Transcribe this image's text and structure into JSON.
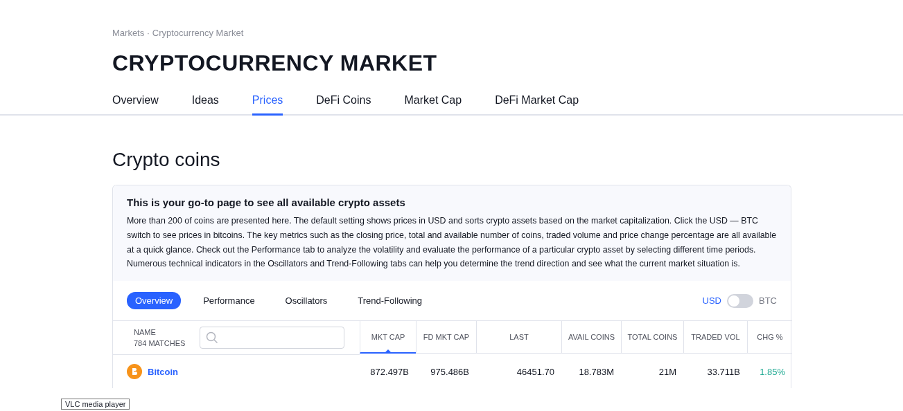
{
  "breadcrumb": "Markets · Cryptocurrency Market",
  "title": "CRYPTOCURRENCY MARKET",
  "tabs": [
    {
      "label": "Overview",
      "selected": false
    },
    {
      "label": "Ideas",
      "selected": false
    },
    {
      "label": "Prices",
      "selected": true
    },
    {
      "label": "DeFi Coins",
      "selected": false
    },
    {
      "label": "Market Cap",
      "selected": false
    },
    {
      "label": "DeFi Market Cap",
      "selected": false
    }
  ],
  "section_title": "Crypto coins",
  "info": {
    "heading": "This is your go-to page to see all available crypto assets",
    "text": "More than 200 of coins are presented here. The default setting shows prices in USD and sorts crypto assets based on the market capitalization. Click the USD — BTC switch to see prices in bitcoins. The key metrics such as the closing price, total and available number of coins, traded volume and price change percentage are all available at a quick glance. Check out the Performance tab to analyze the volatility and evaluate the performance of a particular crypto asset by selecting different time periods. Numerous technical indicators in the Oscillators and Trend-Following tabs can help you determine the trend direction and see what the current market situation is."
  },
  "view_tabs": [
    {
      "label": "Overview",
      "selected": true
    },
    {
      "label": "Performance",
      "selected": false
    },
    {
      "label": "Oscillators",
      "selected": false
    },
    {
      "label": "Trend-Following",
      "selected": false
    }
  ],
  "currency_switch": {
    "left": "USD",
    "right": "BTC",
    "on": false
  },
  "table": {
    "name_header": "NAME",
    "matches": "784 MATCHES",
    "columns": [
      {
        "label": "MKT CAP",
        "selected": true
      },
      {
        "label": "FD MKT CAP",
        "selected": false
      },
      {
        "label": "LAST",
        "selected": false
      },
      {
        "label": "AVAIL COINS",
        "selected": false
      },
      {
        "label": "TOTAL COINS",
        "selected": false
      },
      {
        "label": "TRADED VOL",
        "selected": false
      },
      {
        "label": "CHG %",
        "selected": false,
        "kind": "change"
      }
    ],
    "rows": [
      {
        "name": "Bitcoin",
        "cells": [
          "872.497B",
          "975.486B",
          "46451.70",
          "18.783M",
          "21M",
          "33.711B",
          "1.85%"
        ]
      }
    ]
  },
  "tooltip": "VLC media player"
}
